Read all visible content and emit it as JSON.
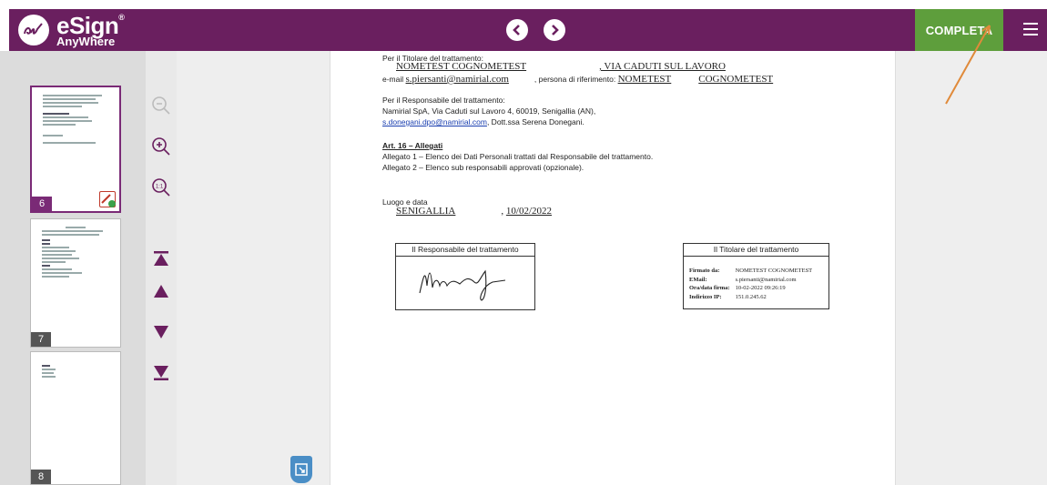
{
  "header": {
    "logo_title": "eSign",
    "logo_sub": "AnyWhere",
    "logo_mark": "®",
    "complete_label": "COMPLETA",
    "colors": {
      "brand": "#6a1f5f",
      "complete": "#5e9e3c"
    }
  },
  "thumbnails": [
    {
      "page": "6"
    },
    {
      "page": "7"
    },
    {
      "page": "8"
    }
  ],
  "document": {
    "owner_label": "Per il Titolare del trattamento:",
    "owner_name": "NOMETEST COGNOMETEST",
    "owner_address": ", VIA CADUTI SUL LAVORO",
    "email_prefix": "e-mail",
    "email_value": "s.piersanti@namirial.com",
    "ref_label": ", persona di riferimento:",
    "ref_name": "NOMETEST",
    "ref_surname": "COGNOMETEST",
    "resp_label": "Per il Responsabile del trattamento:",
    "resp_line1": "Namirial SpA, Via Caduti sul Lavoro 4, 60019, Senigallia (AN),",
    "resp_email": "s.donegani.dpo@namirial.com",
    "resp_line2": ", Dott.ssa Serena Donegani.",
    "art_title": "Art. 16 – Allegati",
    "allegato1": "Allegato 1 – Elenco dei Dati Personali trattati dal Responsabile del trattamento.",
    "allegato2": "Allegato 2 – Elenco sub responsabili approvati (opzionale).",
    "place_label": "Luogo e data",
    "place_value": "SENIGALLIA",
    "date_value": "10/02/2022",
    "resp_box_title": "Il Responsabile del trattamento",
    "owner_box_title": "Il Titolare del trattamento",
    "sig_info": {
      "signed_by_label": "Firmato da:",
      "signed_by": "NOMETEST COGNOMETEST",
      "email_label": "EMail:",
      "email": "s.piersanti@namirial.com",
      "datetime_label": "Ora/data firma:",
      "datetime": "10-02-2022 09:26:19",
      "ip_label": "Indirizzo IP:",
      "ip": "151.0.245.62"
    }
  }
}
